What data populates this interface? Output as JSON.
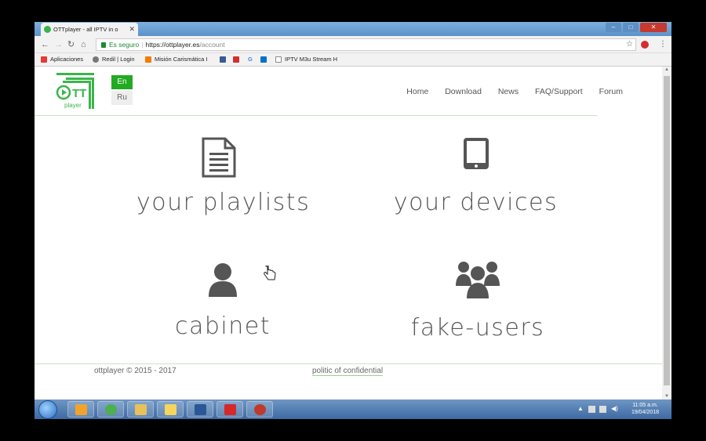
{
  "browser": {
    "tab_title": "OTTplayer - all IPTV in o",
    "tab_close": "✕",
    "window_controls": [
      "–",
      "□",
      "✕"
    ],
    "nav_buttons": {
      "back": "←",
      "forward": "→",
      "reload": "↻",
      "home": "⌂"
    },
    "address": {
      "secure_label": "Es seguro",
      "host": "https://ottplayer.es",
      "path": "/account"
    },
    "bookmarks": [
      {
        "label": "Aplicaciones",
        "icon": "apps-grid-icon",
        "color": "#e53935"
      },
      {
        "label": "Redil | Login",
        "icon": "redil-icon",
        "color": "#777777"
      },
      {
        "label": "Misión Carismática I",
        "icon": "joomla-icon",
        "color": "#f57c00"
      },
      {
        "label": "",
        "icon": "facebook-icon",
        "color": "#3b5998"
      },
      {
        "label": "",
        "icon": "red-bookmark-icon",
        "color": "#d32f2f"
      },
      {
        "label": "",
        "icon": "google-icon",
        "color": "#4285f4"
      },
      {
        "label": "",
        "icon": "outlook-icon",
        "color": "#0072c6"
      },
      {
        "label": "IPTV M3u Stream H",
        "icon": "page-icon",
        "color": "#888888"
      }
    ],
    "star_icon": "☆",
    "menu_icon": "⋮"
  },
  "site": {
    "languages": [
      {
        "label": "En",
        "active": true
      },
      {
        "label": "Ru",
        "active": false
      }
    ],
    "nav": [
      "Home",
      "Download",
      "News",
      "FAQ/Support",
      "Forum"
    ],
    "tiles": [
      {
        "label": "your playlists",
        "icon": "document-icon"
      },
      {
        "label": "your devices",
        "icon": "tablet-icon"
      },
      {
        "label": "cabinet",
        "icon": "user-icon"
      },
      {
        "label": "fake-users",
        "icon": "group-users-icon"
      }
    ],
    "footer": {
      "copyright": "ottplayer © 2015 - 2017",
      "link": "politic of confidential"
    },
    "colors": {
      "brand": "#3ab54a",
      "active_lang": "#22aa22",
      "divider": "#c4e7bb"
    }
  },
  "taskbar": {
    "apps": [
      {
        "name": "media-player",
        "color": "#f2a32b"
      },
      {
        "name": "chrome",
        "color": "#4caf50"
      },
      {
        "name": "explorer",
        "color": "#e8c15a"
      },
      {
        "name": "folder",
        "color": "#f6d55c"
      },
      {
        "name": "word",
        "color": "#2b5797"
      },
      {
        "name": "iptv",
        "color": "#d62828"
      },
      {
        "name": "game",
        "color": "#c0392b"
      }
    ],
    "clock_time": "11:05 a.m.",
    "clock_date": "19/04/2018"
  }
}
